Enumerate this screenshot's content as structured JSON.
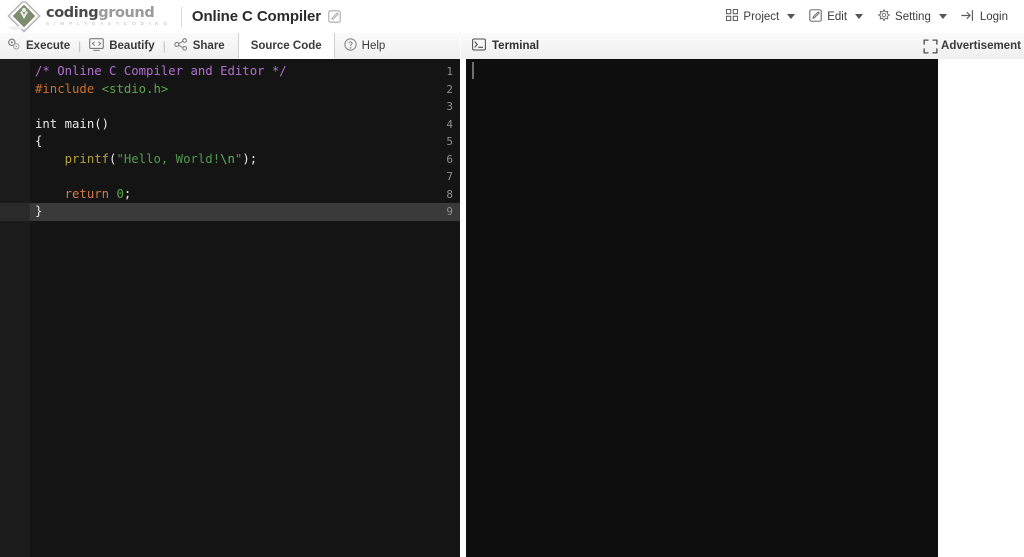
{
  "header": {
    "logo": {
      "word_dark": "coding",
      "word_gray": "ground",
      "tagline": "S I M P L Y E A S Y C O D I N G"
    },
    "title": "Online C Compiler",
    "edit_icon": "pencil-square-icon",
    "menu": [
      {
        "label": "Project",
        "icon": "grid-icon",
        "has_caret": true
      },
      {
        "label": "Edit",
        "icon": "pencil-square-icon",
        "has_caret": true
      },
      {
        "label": "Setting",
        "icon": "gear-icon",
        "has_caret": true
      },
      {
        "label": "Login",
        "icon": "login-arrow-icon",
        "has_caret": false
      }
    ]
  },
  "toolbar": {
    "execute_label": "Execute",
    "execute_icon": "gears-icon",
    "beautify_label": "Beautify",
    "beautify_icon": "monitor-code-icon",
    "share_label": "Share",
    "share_icon": "share-nodes-icon",
    "source_code_label": "Source Code",
    "help_label": "Help",
    "help_icon": "question-circle-icon",
    "divider": "|"
  },
  "terminal_panel": {
    "label": "Terminal",
    "icon": "console-prompt-icon",
    "expand_icon": "fullscreen-expand-icon",
    "advertisement_label": "Advertisement",
    "content": ""
  },
  "editor": {
    "active_line": 9,
    "line_numbers": [
      "1",
      "2",
      "3",
      "4",
      "5",
      "6",
      "7",
      "8",
      "9"
    ],
    "lines": [
      {
        "n": 1,
        "tokens": [
          {
            "t": "/* Online C Compiler and Editor */",
            "c": "tok-comment"
          }
        ]
      },
      {
        "n": 2,
        "tokens": [
          {
            "t": "#include ",
            "c": "tok-pre"
          },
          {
            "t": "<stdio.h>",
            "c": "tok-header"
          }
        ]
      },
      {
        "n": 3,
        "tokens": [
          {
            "t": "",
            "c": "tok-plain"
          }
        ]
      },
      {
        "n": 4,
        "tokens": [
          {
            "t": "int main()",
            "c": "tok-plain"
          }
        ]
      },
      {
        "n": 5,
        "tokens": [
          {
            "t": "{",
            "c": "tok-plain"
          }
        ]
      },
      {
        "n": 6,
        "tokens": [
          {
            "t": "    printf",
            "c": "tok-fn"
          },
          {
            "t": "(",
            "c": "tok-plain"
          },
          {
            "t": "\"Hello, World!",
            "c": "tok-str"
          },
          {
            "t": "\\n",
            "c": "tok-esc"
          },
          {
            "t": "\"",
            "c": "tok-str"
          },
          {
            "t": ");",
            "c": "tok-plain"
          }
        ]
      },
      {
        "n": 7,
        "tokens": [
          {
            "t": "",
            "c": "tok-plain"
          }
        ]
      },
      {
        "n": 8,
        "tokens": [
          {
            "t": "    return",
            "c": "tok-kw"
          },
          {
            "t": " ",
            "c": "tok-plain"
          },
          {
            "t": "0",
            "c": "tok-num"
          },
          {
            "t": ";",
            "c": "tok-plain"
          }
        ]
      },
      {
        "n": 9,
        "tokens": [
          {
            "t": "}",
            "c": "tok-plain"
          }
        ]
      }
    ]
  },
  "colors": {
    "editor_bg": "#141414",
    "gutter_bg": "#1b1b1b",
    "terminal_bg": "#0e0e0e",
    "active_line": "#3a3a3a",
    "comment": "#b06fce",
    "preprocessor": "#c9702a",
    "header_include": "#5da34c",
    "function": "#b3a23a",
    "string": "#4e9a4e",
    "keyword": "#d07a4a",
    "toolbar_bg": "#efefef"
  }
}
